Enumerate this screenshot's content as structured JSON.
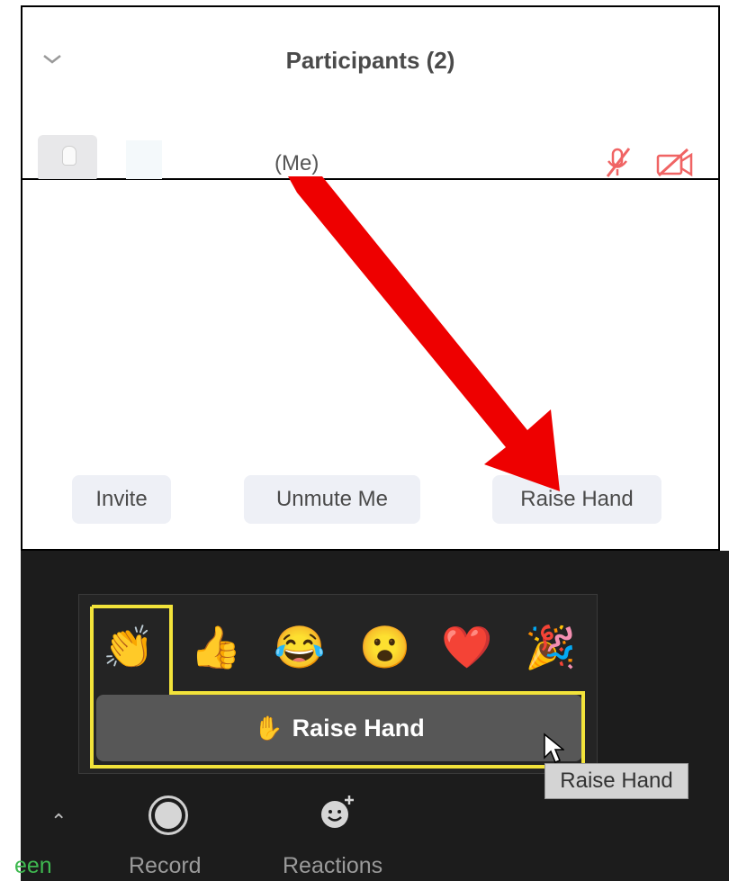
{
  "participants": {
    "title": "Participants (2)",
    "me_label": "(Me)",
    "icons": [
      "chevron-down-icon",
      "mic-muted-icon",
      "video-off-icon"
    ],
    "buttons": {
      "invite": "Invite",
      "unmute": "Unmute Me",
      "raise_hand": "Raise Hand"
    }
  },
  "reactions_popup": {
    "emojis": [
      "👏",
      "👍",
      "😂",
      "😮",
      "❤️",
      "🎉"
    ],
    "raise_hand_label": "Raise Hand",
    "hand_emoji": "✋",
    "tooltip": "Raise Hand"
  },
  "toolbar": {
    "share_label": "een",
    "record_label": "Record",
    "reactions_label": "Reactions"
  },
  "colors": {
    "arrow": "#ee0000",
    "highlight": "#f2e33a",
    "muted_icon": "#f06464",
    "share_green": "#3fb950"
  }
}
